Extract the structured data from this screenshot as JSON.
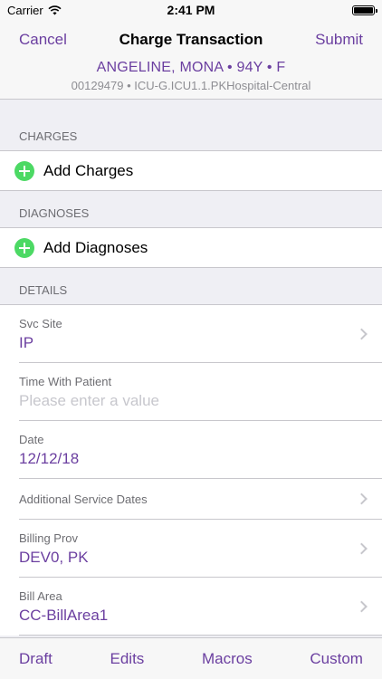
{
  "status_bar": {
    "carrier": "Carrier",
    "time": "2:41 PM"
  },
  "nav": {
    "cancel": "Cancel",
    "title": "Charge Transaction",
    "submit": "Submit",
    "patient": "ANGELINE, MONA • 94Y • F",
    "location": "00129479 • ICU-G.ICU1.1.PKHospital-Central"
  },
  "charges": {
    "header": "CHARGES",
    "add_label": "Add Charges"
  },
  "diagnoses": {
    "header": "DIAGNOSES",
    "add_label": "Add Diagnoses"
  },
  "details": {
    "header": "DETAILS",
    "svc_site": {
      "label": "Svc Site",
      "value": "IP"
    },
    "time_with_patient": {
      "label": "Time With Patient",
      "placeholder": "Please enter a value"
    },
    "date": {
      "label": "Date",
      "value": "12/12/18"
    },
    "additional_service_dates": {
      "label": "Additional Service Dates"
    },
    "billing_prov": {
      "label": "Billing Prov",
      "value": "DEV0, PK"
    },
    "bill_area": {
      "label": "Bill Area",
      "value": "CC-BillArea1"
    }
  },
  "toolbar": {
    "draft": "Draft",
    "edits": "Edits",
    "macros": "Macros",
    "custom": "Custom"
  },
  "colors": {
    "accent": "#6b3fa0",
    "add_green": "#4cd964",
    "background": "#efeff4"
  }
}
